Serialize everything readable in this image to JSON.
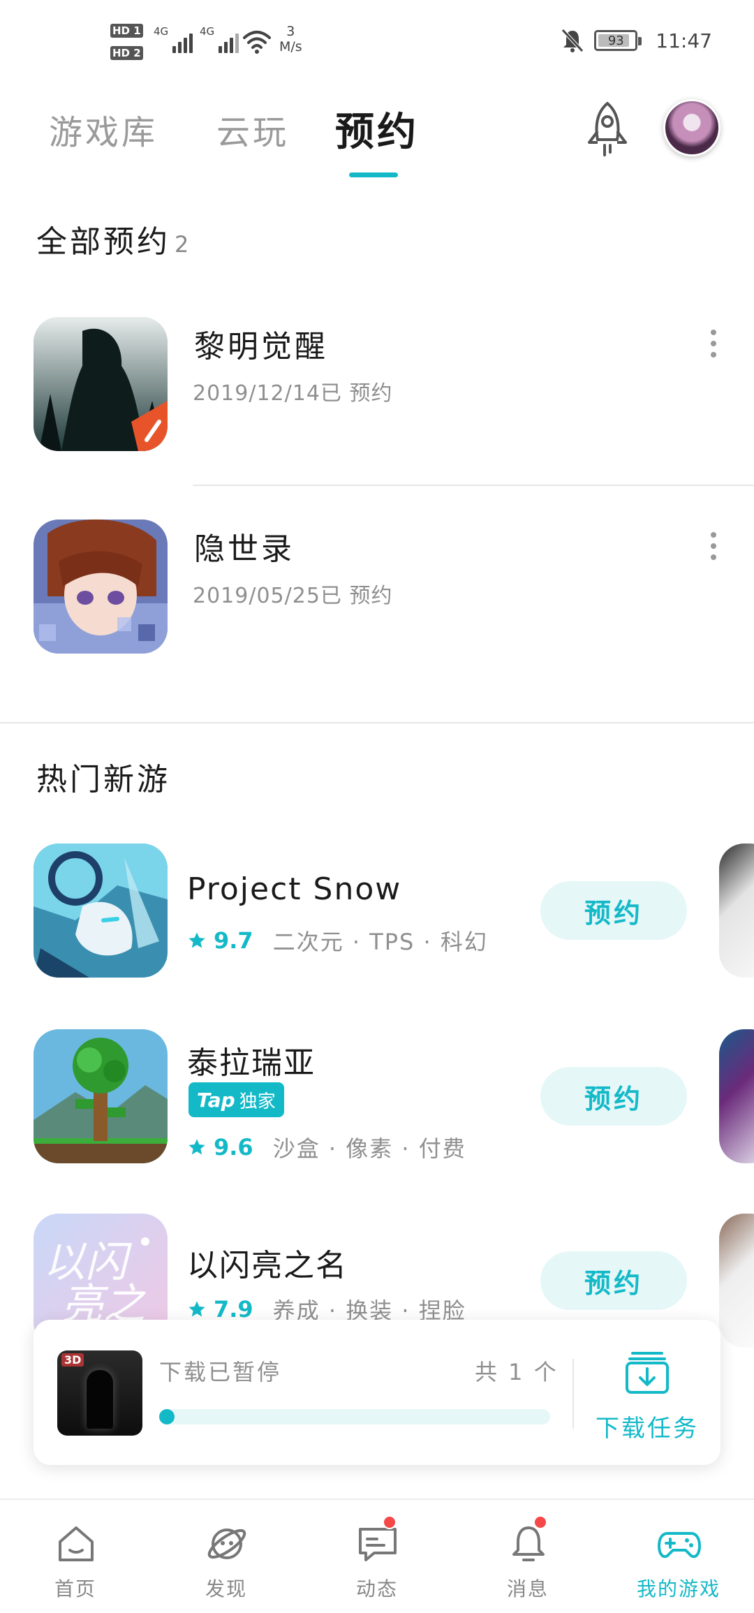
{
  "status_bar": {
    "hd1": "HD 1",
    "hd2": "HD 2",
    "net1": "4G",
    "net2": "4G",
    "speed_value": "3",
    "speed_unit": "M/s",
    "battery": "93",
    "time": "11:47",
    "icons": [
      "signal-icon",
      "wifi-icon",
      "mute-bell-icon",
      "battery-icon"
    ]
  },
  "top_tabs": {
    "items": [
      {
        "label": "游戏库"
      },
      {
        "label": "云玩"
      },
      {
        "label": "预约"
      }
    ],
    "active_index": 2,
    "accent": "#14b9c8"
  },
  "reserved": {
    "title": "全部预约",
    "count": "2",
    "items": [
      {
        "name": "黎明觉醒",
        "date": "2019/12/14已 预约"
      },
      {
        "name": "隐世录",
        "date": "2019/05/25已 预约"
      }
    ]
  },
  "hot": {
    "title": "热门新游",
    "items": [
      {
        "name": "Project Snow",
        "score": "9.7",
        "tags": "二次元 · TPS · 科幻",
        "button": "预约"
      },
      {
        "name": "泰拉瑞亚",
        "badge_tap": "Tap",
        "badge_text": "独家",
        "score": "9.6",
        "tags": "沙盒 · 像素 · 付费",
        "button": "预约"
      },
      {
        "name": "以闪亮之名",
        "score": "7.9",
        "tags": "养成 · 换装 · 捏脸",
        "button": "预约"
      }
    ]
  },
  "download": {
    "thumb_tag": "3D",
    "status": "下载已暂停",
    "count": "共 1 个",
    "progress": 0.03,
    "task_label": "下载任务"
  },
  "bottom_nav": {
    "items": [
      {
        "label": "首页",
        "icon": "home-icon"
      },
      {
        "label": "发现",
        "icon": "planet-icon"
      },
      {
        "label": "动态",
        "icon": "chat-icon"
      },
      {
        "label": "消息",
        "icon": "bell-icon"
      },
      {
        "label": "我的游戏",
        "icon": "gamepad-icon"
      }
    ],
    "active_index": 4
  }
}
